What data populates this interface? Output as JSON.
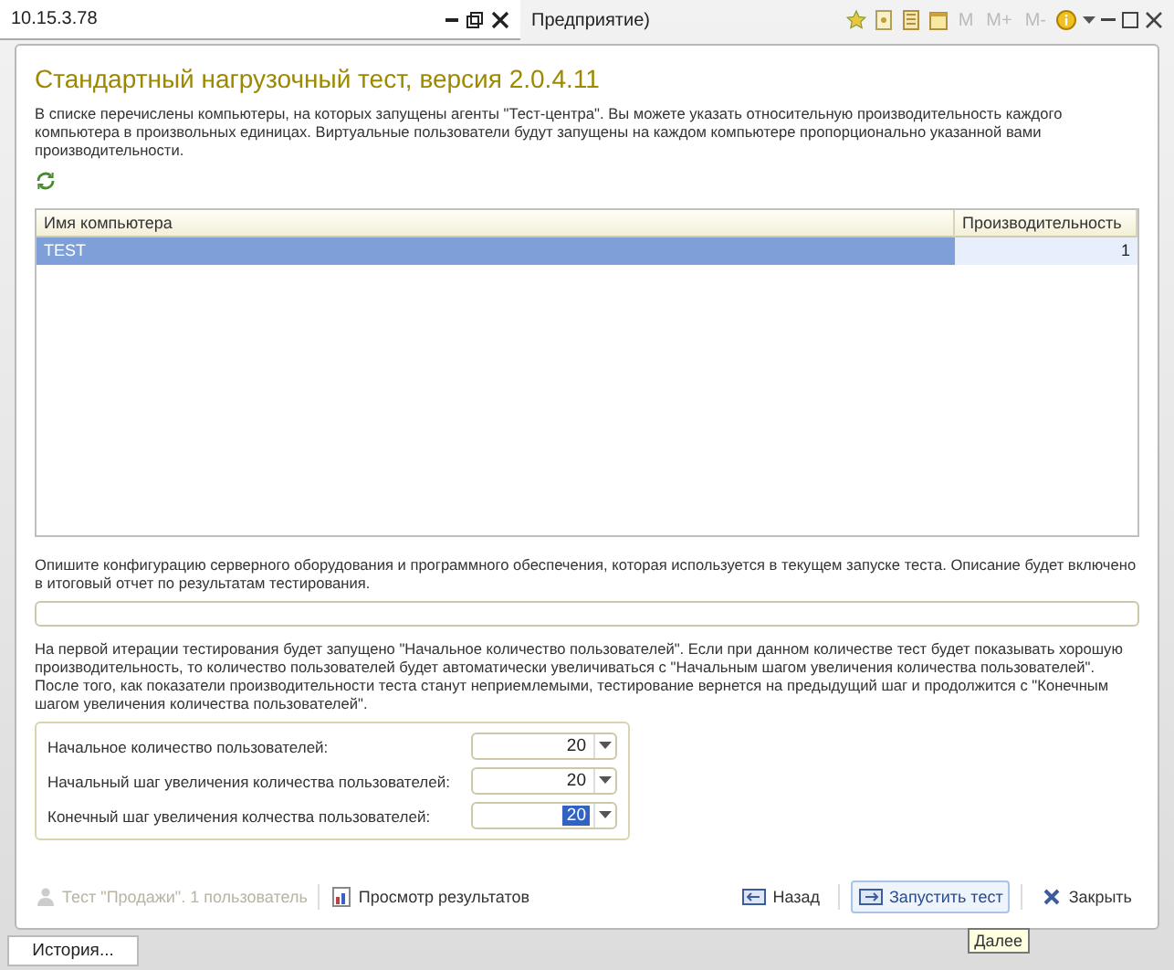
{
  "window": {
    "title": "10.15.3.78",
    "app_tab": "Предприятие)"
  },
  "toolbar": [
    {
      "kind": "icon"
    },
    {
      "kind": "icon"
    },
    {
      "kind": "icon"
    },
    {
      "kind": "icon"
    },
    {
      "kind": "text",
      "label": "M",
      "disabled": true
    },
    {
      "kind": "text",
      "label": "M+",
      "disabled": true
    },
    {
      "kind": "text",
      "label": "M-",
      "disabled": true
    },
    {
      "kind": "icon"
    }
  ],
  "heading": "Стандартный нагрузочный тест, версия 2.0.4.11",
  "intro": "В списке перечислены компьютеры, на которых запущены агенты \"Тест-центра\". Вы можете указать относительную производительность каждого компьютера в произвольных единицах. Виртуальные пользователи будут запущены на каждом компьютере пропорционально указанной вами производительности.",
  "table": {
    "columns": [
      "Имя компьютера",
      "Производительность"
    ],
    "rows": [
      {
        "cells": [
          "TEST",
          "1"
        ],
        "selected": true
      }
    ]
  },
  "config_prompt": "Опишите конфигурацию серверного оборудования и программного обеспечения, которая используется в текущем запуске теста. Описание будет включено в итоговый отчет по результатам тестирования.",
  "iteration_note": "На первой итерации тестирования будет запущено \"Начальное количество пользователей\". Если при данном количестве тест будет показывать хорошую производительность, то количество пользователей будет автоматически увеличиваться с \"Начальным шагом увеличения количества пользователей\". После того, как показатели производительности теста станут неприемлемыми, тестирование вернется на предыдущий шаг и продолжится с \"Конечным шагом увеличения количества пользователей\".",
  "fields": [
    {
      "label": "Начальное количество пользователей:",
      "value": "20",
      "focused": false
    },
    {
      "label": "Начальный шаг увеличения количества пользователей:",
      "value": "20",
      "focused": false
    },
    {
      "label": "Конечный шаг увеличения колчества пользователей:",
      "value": "20",
      "focused": true
    }
  ],
  "footer_links": [
    {
      "label": "Тест \"Продажи\". 1 пользователь",
      "disabled": true
    },
    {
      "label": "Просмотр результатов",
      "disabled": false
    }
  ],
  "buttons": [
    {
      "label": "Назад",
      "hovered": false
    },
    {
      "label": "Запустить тест",
      "hovered": true
    },
    {
      "label": "Закрыть",
      "hovered": false
    }
  ],
  "tooltip": "Далее",
  "taskbar": {
    "button": "История..."
  }
}
